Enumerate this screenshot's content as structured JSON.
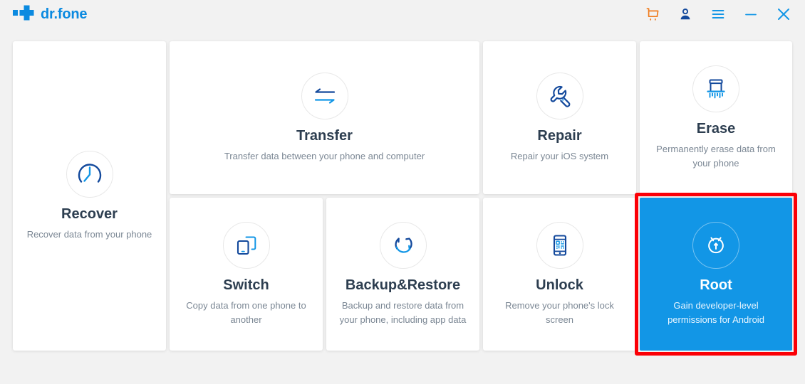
{
  "app": {
    "brand_name": "dr.fone",
    "logo_icon": "plus-cross-logo",
    "accent_blue": "#0b8ae0",
    "icon_dark_blue": "#13499c",
    "icon_light_blue": "#1296e6",
    "background": "#f2f2f2",
    "card_background": "#ffffff",
    "title_color": "#2d3e50",
    "desc_color": "#7b8794",
    "highlight_color": "#fb0007",
    "selected_card_color": "#1296e6"
  },
  "titlebar": {
    "actions": [
      {
        "name": "cart-icon",
        "label": "Shopping cart",
        "color": "#f07c1e"
      },
      {
        "name": "user-icon",
        "label": "Account",
        "color": "#13499c"
      },
      {
        "name": "menu-icon",
        "label": "Menu",
        "color": "#1296e6"
      },
      {
        "name": "minimize-icon",
        "label": "Minimize",
        "color": "#1296e6"
      },
      {
        "name": "close-icon",
        "label": "Close",
        "color": "#1296e6"
      }
    ]
  },
  "cards": [
    {
      "id": "recover",
      "title": "Recover",
      "desc": "Recover data from your phone",
      "icon": "clock-recover-icon",
      "selected": false,
      "highlighted": false
    },
    {
      "id": "transfer",
      "title": "Transfer",
      "desc": "Transfer data between your phone and computer",
      "icon": "two-way-arrows-icon",
      "selected": false,
      "highlighted": false
    },
    {
      "id": "repair",
      "title": "Repair",
      "desc": "Repair your iOS system",
      "icon": "wrench-icon",
      "selected": false,
      "highlighted": false
    },
    {
      "id": "erase",
      "title": "Erase",
      "desc": "Permanently erase data from your phone",
      "icon": "shredder-icon",
      "selected": false,
      "highlighted": false
    },
    {
      "id": "switch",
      "title": "Switch",
      "desc": "Copy data from one phone to another",
      "icon": "two-phones-icon",
      "selected": false,
      "highlighted": false
    },
    {
      "id": "backup",
      "title": "Backup&Restore",
      "desc": "Backup and restore data from your phone, including app data",
      "icon": "circular-sync-icon",
      "selected": false,
      "highlighted": false
    },
    {
      "id": "unlock",
      "title": "Unlock",
      "desc": "Remove your phone's lock screen",
      "icon": "phone-qr-lock-icon",
      "selected": false,
      "highlighted": false
    },
    {
      "id": "root",
      "title": "Root",
      "desc": "Gain developer-level permissions for Android",
      "icon": "android-root-icon",
      "selected": true,
      "highlighted": true
    }
  ]
}
